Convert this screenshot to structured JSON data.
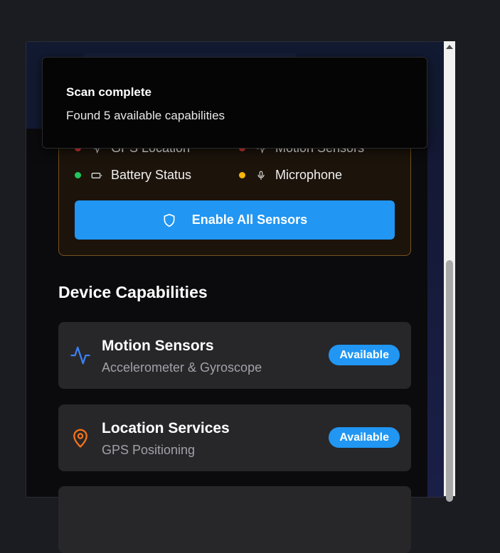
{
  "permissions_panel": {
    "items": [
      {
        "label": "GPS Location",
        "dot_color": "#e53935",
        "icon": "location-outline-icon"
      },
      {
        "label": "Motion Sensors",
        "dot_color": "#e53935",
        "icon": "activity-icon"
      },
      {
        "label": "Battery Status",
        "dot_color": "#22c55e",
        "icon": "battery-icon"
      },
      {
        "label": "Microphone",
        "dot_color": "#f5b50a",
        "icon": "microphone-icon"
      }
    ],
    "enable_button_label": "Enable All Sensors",
    "enable_button_icon": "shield-icon"
  },
  "capabilities": {
    "title": "Device Capabilities",
    "cards": [
      {
        "title": "Motion Sensors",
        "subtitle": "Accelerometer & Gyroscope",
        "badge": "Available",
        "icon": "activity-icon",
        "icon_color": "#3b82f6"
      },
      {
        "title": "Location Services",
        "subtitle": "GPS Positioning",
        "badge": "Available",
        "icon": "map-pin-icon",
        "icon_color": "#f97316"
      }
    ]
  },
  "toast": {
    "title": "Scan complete",
    "description": "Found 5 available capabilities"
  },
  "colors": {
    "accent": "#2196f3",
    "warning_border": "#7a5220",
    "card_bg": "#27272a"
  }
}
